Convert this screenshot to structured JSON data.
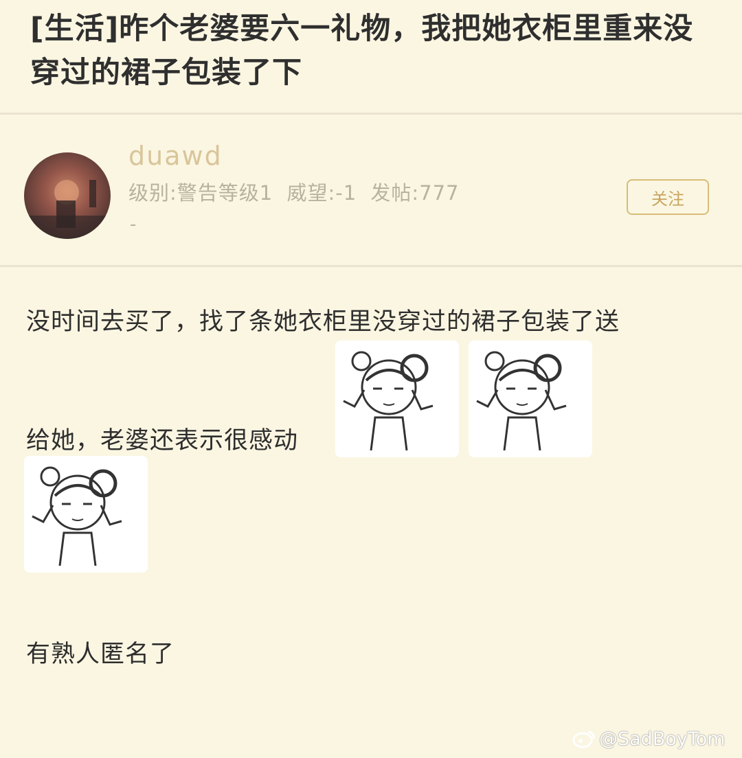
{
  "post": {
    "title": "[生活]昨个老婆要六一礼物，我把她衣柜里重来没穿过的裙子包装了下",
    "author": {
      "name": "duawd",
      "level": "级别:警告等级1",
      "prestige": "威望:-1",
      "posts": "发帖:777",
      "extra": "-"
    },
    "follow_label": "关注",
    "body": [
      "没时间去买了，找了条她衣柜里没穿过的裙子包装了送",
      "给她，老婆还表示很感动",
      "有熟人匿名了"
    ]
  },
  "watermark": {
    "text": "@SadBoyTom"
  },
  "colors": {
    "background": "#fbf6e2",
    "accent": "#d7bc77",
    "username": "#d8c59a",
    "muted": "#b8b1a0"
  }
}
